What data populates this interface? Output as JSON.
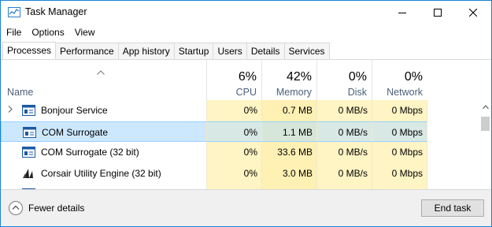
{
  "window": {
    "title": "Task Manager"
  },
  "menu": [
    "File",
    "Options",
    "View"
  ],
  "tabs": [
    "Processes",
    "Performance",
    "App history",
    "Startup",
    "Users",
    "Details",
    "Services"
  ],
  "header": {
    "name_label": "Name",
    "cpu": {
      "pct": "6%",
      "label": "CPU"
    },
    "memory": {
      "pct": "42%",
      "label": "Memory"
    },
    "disk": {
      "pct": "0%",
      "label": "Disk"
    },
    "network": {
      "pct": "0%",
      "label": "Network"
    }
  },
  "processes": [
    {
      "name": "Bonjour Service",
      "cpu": "0%",
      "memory": "0.7 MB",
      "disk": "0 MB/s",
      "network": "0 Mbps",
      "expandable": true,
      "icon": "service-icon"
    },
    {
      "name": "COM Surrogate",
      "cpu": "0%",
      "memory": "1.1 MB",
      "disk": "0 MB/s",
      "network": "0 Mbps",
      "expandable": false,
      "icon": "app-window-icon",
      "selected": true
    },
    {
      "name": "COM Surrogate (32 bit)",
      "cpu": "0%",
      "memory": "33.6 MB",
      "disk": "0 MB/s",
      "network": "0 Mbps",
      "expandable": false,
      "icon": "app-window-icon"
    },
    {
      "name": "Corsair Utility Engine (32 bit)",
      "cpu": "0%",
      "memory": "3.0 MB",
      "disk": "0 MB/s",
      "network": "0 Mbps",
      "expandable": false,
      "icon": "corsair-sails-icon"
    }
  ],
  "footer": {
    "fewer_details": "Fewer details",
    "end_task": "End task"
  },
  "colors": {
    "accent": "#1783d4",
    "selection": "#cce8ff",
    "heat_light": "#fff4c4",
    "heat_medium": "#fff0b3"
  }
}
